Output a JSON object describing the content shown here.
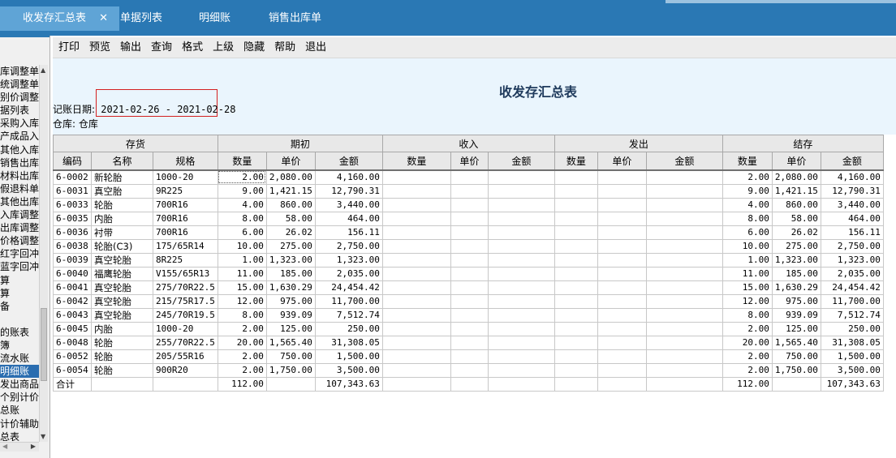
{
  "tabs": [
    {
      "label": "收发存汇总表",
      "active": true
    },
    {
      "label": "单据列表"
    },
    {
      "label": "明细账"
    },
    {
      "label": "销售出库单"
    }
  ],
  "nav_items": [
    "库调整单",
    "统调整单",
    "别价调整",
    "据列表",
    "采购入库",
    "产成品入",
    "其他入库",
    "销售出库",
    "材料出库",
    "假退料单",
    "其他出库",
    "入库调整",
    "出库调整",
    "价格调整",
    "红字回冲",
    "蓝字回冲",
    "算",
    "算",
    "备",
    "",
    "的账表",
    "簿",
    "流水账",
    "明细账",
    "发出商品",
    "个别计价",
    "总账",
    "计价辅助",
    "总表"
  ],
  "nav_selected_index": 23,
  "toolbar": [
    "打印",
    "预览",
    "输出",
    "查询",
    "格式",
    "上级",
    "隐藏",
    "帮助",
    "退出"
  ],
  "report": {
    "title": "收发存汇总表",
    "date_label": "记账日期:",
    "date_range": "2021-02-26 - 2021-02-28",
    "warehouse": "仓库: 仓库"
  },
  "table": {
    "groups": [
      "存货",
      "期初",
      "收入",
      "发出",
      "结存"
    ],
    "columns": [
      "编码",
      "名称",
      "规格",
      "数量",
      "单价",
      "金额",
      "数量",
      "单价",
      "金额",
      "数量",
      "单价",
      "金额",
      "数量",
      "单价",
      "金额"
    ],
    "rows": [
      [
        "6-0002",
        "新轮胎",
        "1000-20",
        "2.00",
        "2,080.00",
        "4,160.00",
        "",
        "",
        "",
        "",
        "",
        "",
        "2.00",
        "2,080.00",
        "4,160.00"
      ],
      [
        "6-0031",
        "真空胎",
        "9R225",
        "9.00",
        "1,421.15",
        "12,790.31",
        "",
        "",
        "",
        "",
        "",
        "",
        "9.00",
        "1,421.15",
        "12,790.31"
      ],
      [
        "6-0033",
        "轮胎",
        "700R16",
        "4.00",
        "860.00",
        "3,440.00",
        "",
        "",
        "",
        "",
        "",
        "",
        "4.00",
        "860.00",
        "3,440.00"
      ],
      [
        "6-0035",
        "内胎",
        "700R16",
        "8.00",
        "58.00",
        "464.00",
        "",
        "",
        "",
        "",
        "",
        "",
        "8.00",
        "58.00",
        "464.00"
      ],
      [
        "6-0036",
        "衬带",
        "700R16",
        "6.00",
        "26.02",
        "156.11",
        "",
        "",
        "",
        "",
        "",
        "",
        "6.00",
        "26.02",
        "156.11"
      ],
      [
        "6-0038",
        "轮胎(C3)",
        "175/65R14",
        "10.00",
        "275.00",
        "2,750.00",
        "",
        "",
        "",
        "",
        "",
        "",
        "10.00",
        "275.00",
        "2,750.00"
      ],
      [
        "6-0039",
        "真空轮胎",
        "8R225",
        "1.00",
        "1,323.00",
        "1,323.00",
        "",
        "",
        "",
        "",
        "",
        "",
        "1.00",
        "1,323.00",
        "1,323.00"
      ],
      [
        "6-0040",
        "福鹰轮胎",
        "V155/65R13",
        "11.00",
        "185.00",
        "2,035.00",
        "",
        "",
        "",
        "",
        "",
        "",
        "11.00",
        "185.00",
        "2,035.00"
      ],
      [
        "6-0041",
        "真空轮胎",
        "275/70R22.5",
        "15.00",
        "1,630.29",
        "24,454.42",
        "",
        "",
        "",
        "",
        "",
        "",
        "15.00",
        "1,630.29",
        "24,454.42"
      ],
      [
        "6-0042",
        "真空轮胎",
        "215/75R17.5",
        "12.00",
        "975.00",
        "11,700.00",
        "",
        "",
        "",
        "",
        "",
        "",
        "12.00",
        "975.00",
        "11,700.00"
      ],
      [
        "6-0043",
        "真空轮胎",
        "245/70R19.5",
        "8.00",
        "939.09",
        "7,512.74",
        "",
        "",
        "",
        "",
        "",
        "",
        "8.00",
        "939.09",
        "7,512.74"
      ],
      [
        "6-0045",
        "内胎",
        "1000-20",
        "2.00",
        "125.00",
        "250.00",
        "",
        "",
        "",
        "",
        "",
        "",
        "2.00",
        "125.00",
        "250.00"
      ],
      [
        "6-0048",
        "轮胎",
        "255/70R22.5",
        "20.00",
        "1,565.40",
        "31,308.05",
        "",
        "",
        "",
        "",
        "",
        "",
        "20.00",
        "1,565.40",
        "31,308.05"
      ],
      [
        "6-0052",
        "轮胎",
        "205/55R16",
        "2.00",
        "750.00",
        "1,500.00",
        "",
        "",
        "",
        "",
        "",
        "",
        "2.00",
        "750.00",
        "1,500.00"
      ],
      [
        "6-0054",
        "轮胎",
        "900R20",
        "2.00",
        "1,750.00",
        "3,500.00",
        "",
        "",
        "",
        "",
        "",
        "",
        "2.00",
        "1,750.00",
        "3,500.00"
      ]
    ],
    "total": [
      "合计",
      "",
      "",
      "112.00",
      "",
      "107,343.63",
      "",
      "",
      "",
      "",
      "",
      "",
      "112.00",
      "",
      "107,343.63"
    ]
  },
  "colors": {
    "tabbar": "#2a78b4",
    "active_tab": "#5fa4d6",
    "report_header": "#eaf5fd",
    "highlight_box": "#d42020"
  },
  "icons": [
    "close-icon",
    "scroll-up-arrow-icon",
    "scroll-down-arrow-icon",
    "scroll-left-arrow-icon",
    "scroll-right-arrow-icon"
  ]
}
